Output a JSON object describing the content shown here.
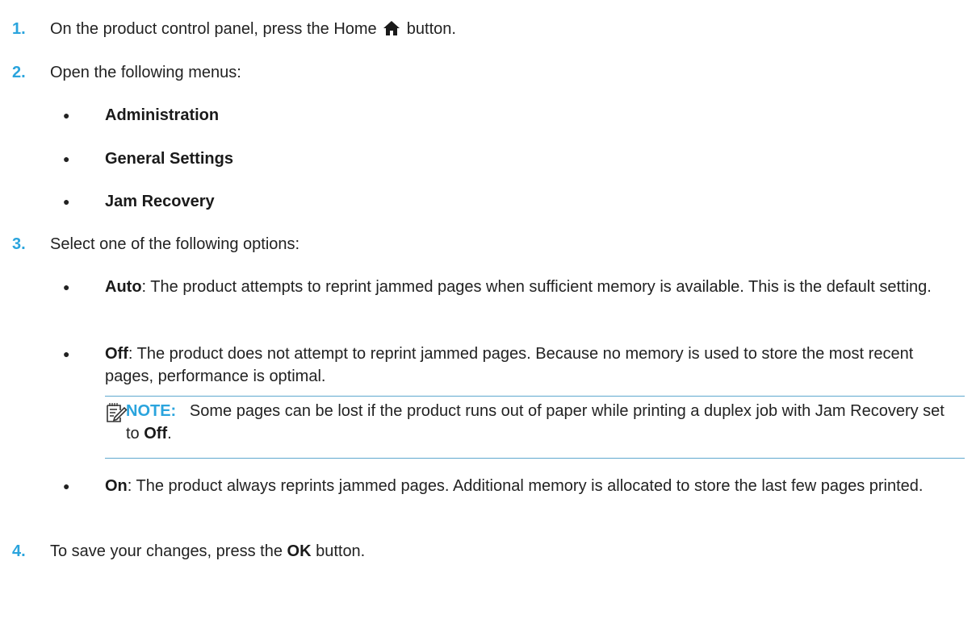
{
  "steps": [
    {
      "number": "1.",
      "text_before": "On the product control panel, press the Home",
      "text_after": "button."
    },
    {
      "number": "2.",
      "text": "Open the following menus:"
    },
    {
      "number": "3.",
      "text": "Select one of the following options:"
    },
    {
      "number": "4.",
      "text_before": "To save your changes, press the",
      "bold": "OK",
      "text_after": "button."
    }
  ],
  "menus": [
    "Administration",
    "General Settings",
    "Jam Recovery"
  ],
  "options": [
    {
      "label": "Auto",
      "desc": ": The product attempts to reprint jammed pages when sufficient memory is available. This is the default setting."
    },
    {
      "label": "Off",
      "desc": ": The product does not attempt to reprint jammed pages. Because no memory is used to store the most recent pages, performance is optimal."
    },
    {
      "label": "On",
      "desc": ": The product always reprints jammed pages. Additional memory is allocated to store the last few pages printed."
    }
  ],
  "note": {
    "label": "NOTE:",
    "text": "Some pages can be lost if the product runs out of paper while printing a duplex job with Jam Recovery set to",
    "bold": "Off",
    "end": "."
  },
  "colors": {
    "accent": "#2aa4dd",
    "rule": "#5fa9cf"
  },
  "icons": [
    "home-icon",
    "note-icon"
  ]
}
